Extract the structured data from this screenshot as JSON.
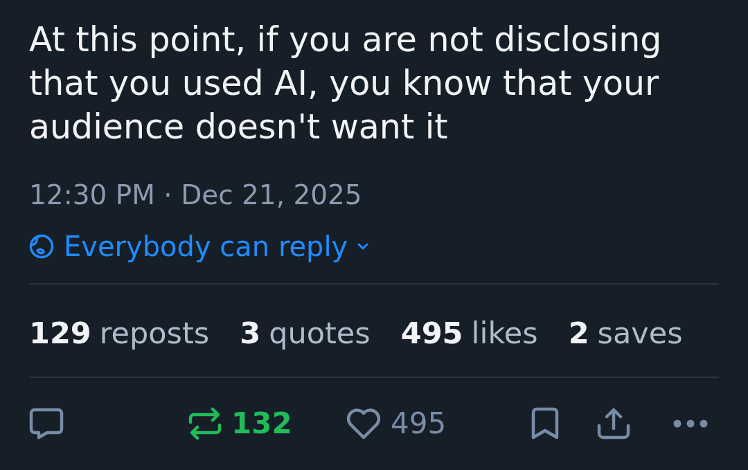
{
  "post": {
    "text": "At this point, if you are not disclosing that you used AI, you know that your audience doesn't want it",
    "timestamp": "12:30 PM · Dec 21, 2025",
    "reply_setting": "Everybody can reply"
  },
  "stats": [
    {
      "count": "129",
      "label": "reposts"
    },
    {
      "count": "3",
      "label": "quotes"
    },
    {
      "count": "495",
      "label": "likes"
    },
    {
      "count": "2",
      "label": "saves"
    }
  ],
  "actions": [
    {
      "kind": "reply"
    },
    {
      "kind": "repost",
      "count": "132",
      "active": true
    },
    {
      "kind": "like",
      "count": "495",
      "active": false
    },
    {
      "kind": "bookmark",
      "active": false
    },
    {
      "kind": "share"
    },
    {
      "kind": "more"
    }
  ]
}
